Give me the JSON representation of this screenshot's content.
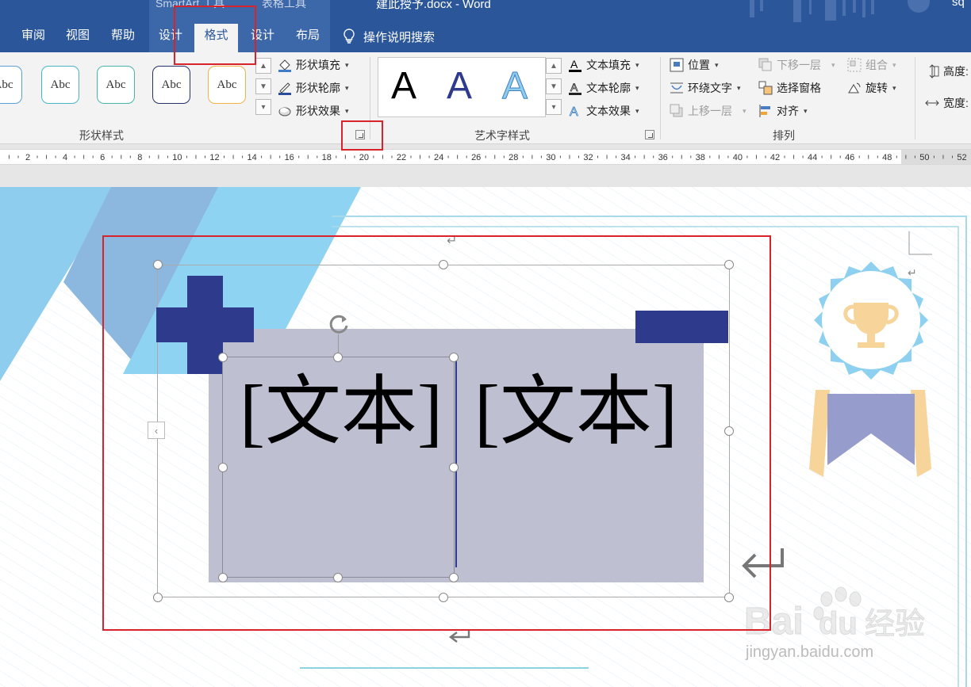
{
  "window": {
    "doc_title": "建此授予.docx  -  Word",
    "ctx_smartart": "SmartArt 工具",
    "ctx_table": "表格工具",
    "user": "sq"
  },
  "tabs": [
    {
      "label": "审阅"
    },
    {
      "label": "视图"
    },
    {
      "label": "帮助"
    },
    {
      "label": "设计"
    },
    {
      "label": "格式"
    },
    {
      "label": "设计"
    },
    {
      "label": "布局"
    }
  ],
  "active_tab": "格式",
  "tell_me": "操作说明搜索",
  "ribbon": {
    "shape_styles": {
      "label": "形状样式",
      "preset_text": "Abc",
      "fill": "形状填充",
      "outline": "形状轮廓",
      "effects": "形状效果"
    },
    "wordart": {
      "label": "艺术字样式",
      "sample": "A",
      "fill": "文本填充",
      "outline": "文本轮廓",
      "effects": "文本效果"
    },
    "arrange": {
      "label": "排列",
      "position": "位置",
      "wrap": "环绕文字",
      "bring_forward": "上移一层",
      "send_backward": "下移一层",
      "selection_pane": "选择窗格",
      "align": "对齐",
      "group": "组合",
      "rotate": "旋转"
    },
    "size": {
      "height": "高度:",
      "width": "宽度:"
    }
  },
  "ruler": [
    "2",
    "4",
    "6",
    "8",
    "10",
    "12",
    "14",
    "16",
    "18",
    "20",
    "22",
    "24",
    "26",
    "28",
    "30",
    "32",
    "34",
    "36",
    "38",
    "40",
    "42",
    "44",
    "46",
    "48",
    "50",
    "52"
  ],
  "document": {
    "text_left": "[文本]",
    "text_right": "[文本]"
  },
  "watermark": {
    "logo": "Bai du 经验",
    "url": "jingyan.baidu.com"
  },
  "colors": {
    "title_bar": "#2b579a",
    "highlight": "#d9232a",
    "smartart_fill": "#bfbfd2",
    "dark_blue": "#2e3a8c",
    "light_blue": "#8fcdee"
  }
}
